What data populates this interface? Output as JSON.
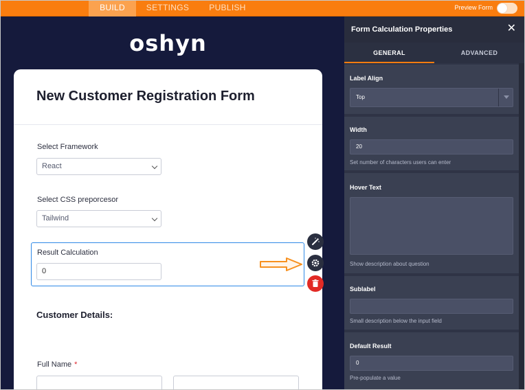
{
  "topbar": {
    "tabs": [
      {
        "label": "BUILD",
        "active": true
      },
      {
        "label": "SETTINGS",
        "active": false
      },
      {
        "label": "PUBLISH",
        "active": false
      }
    ],
    "preview_label": "Preview Form",
    "accent_color": "#f97d0f"
  },
  "canvas": {
    "logo": "oshyn",
    "form_title": "New Customer Registration Form",
    "fields": {
      "framework": {
        "label": "Select Framework",
        "value": "React"
      },
      "css": {
        "label": "Select CSS preporcesor",
        "value": "Tailwind"
      },
      "result": {
        "label": "Result Calculation",
        "value": "0"
      },
      "section_title": "Customer Details:",
      "full_name": {
        "label": "Full Name",
        "required_mark": "*"
      }
    },
    "side_buttons": {
      "wand": "magic-wand-icon",
      "gear": "gear-icon",
      "trash": "trash-icon"
    }
  },
  "panel": {
    "title": "Form Calculation Properties",
    "close": "✕",
    "tabs": [
      {
        "label": "GENERAL",
        "active": true
      },
      {
        "label": "ADVANCED",
        "active": false
      }
    ],
    "label_align": {
      "label": "Label Align",
      "value": "Top"
    },
    "width": {
      "label": "Width",
      "value": "20",
      "help": "Set number of characters users can enter"
    },
    "hover_text": {
      "label": "Hover Text",
      "value": "",
      "help": "Show description about question"
    },
    "sublabel": {
      "label": "Sublabel",
      "value": "",
      "help": "Small description below the input field"
    },
    "default_result": {
      "label": "Default Result",
      "value": "0",
      "help": "Pre-populate a value"
    }
  }
}
